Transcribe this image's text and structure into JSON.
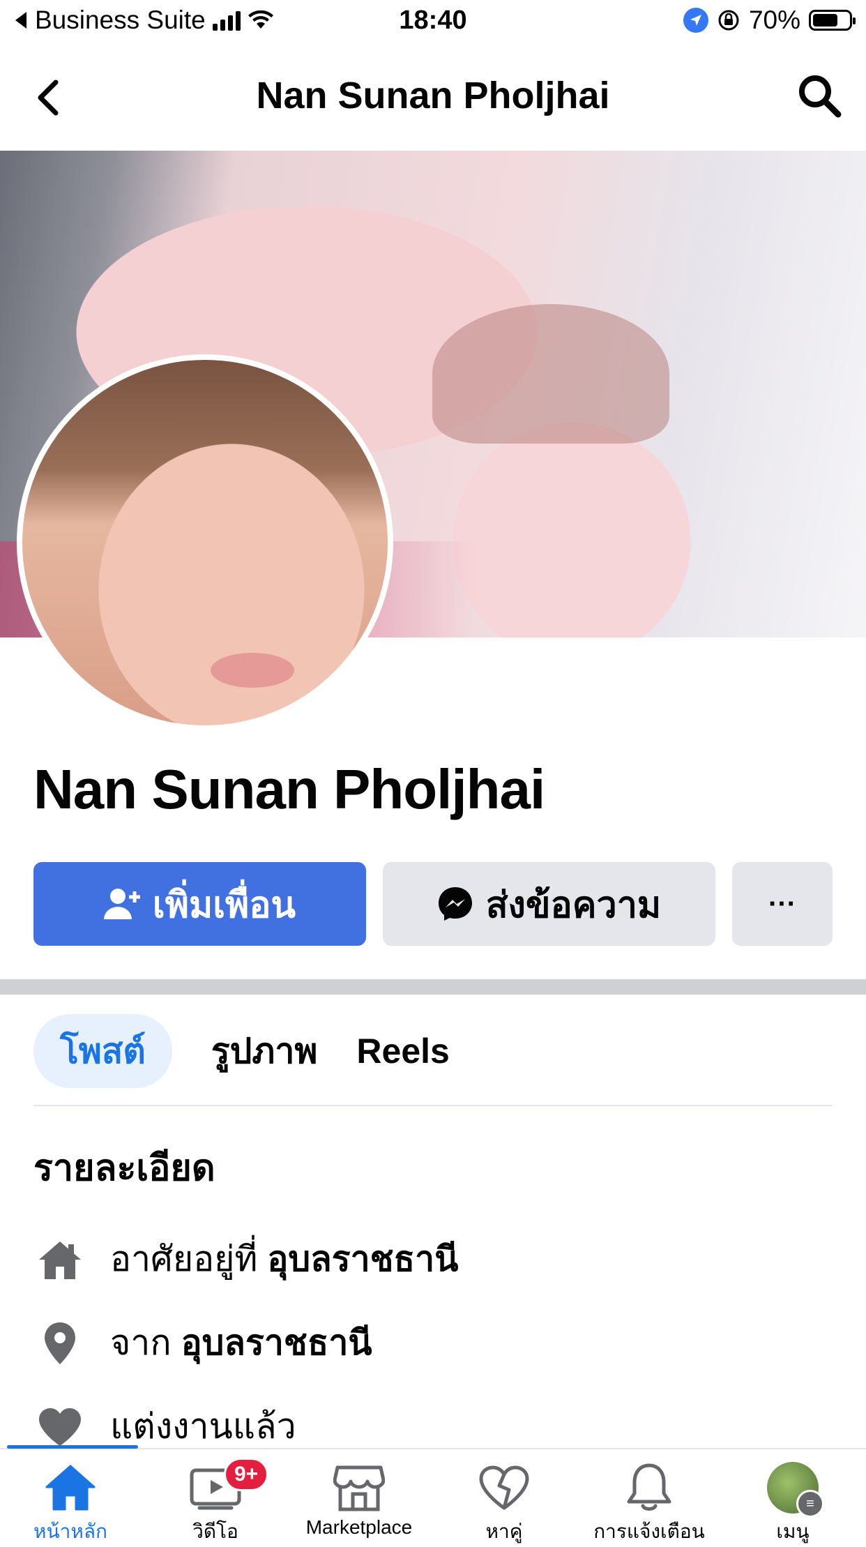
{
  "status_bar": {
    "carrier": "Business Suite",
    "time": "18:40",
    "battery": "70%",
    "battery_level": 0.7
  },
  "header": {
    "title": "Nan Sunan Pholjhai"
  },
  "profile": {
    "name": "Nan Sunan Pholjhai"
  },
  "actions": {
    "add_friend": "เพิ่มเพื่อน",
    "message": "ส่งข้อความ",
    "more": "···"
  },
  "tabs": [
    {
      "label": "โพสต์",
      "active": true
    },
    {
      "label": "รูปภาพ",
      "active": false
    },
    {
      "label": "Reels",
      "active": false
    }
  ],
  "details": {
    "title": "รายละเอียด",
    "items": [
      {
        "icon": "home-icon",
        "prefix": "อาศัยอยู่ที่",
        "value": "อุบลราชธานี"
      },
      {
        "icon": "location-pin-icon",
        "prefix": "จาก",
        "value": "อุบลราชธานี"
      },
      {
        "icon": "heart-icon",
        "prefix": "แต่งงานแล้ว",
        "value": ""
      }
    ]
  },
  "tabbar": {
    "items": [
      {
        "label": "หน้าหลัก",
        "icon": "home-icon"
      },
      {
        "label": "วิดีโอ",
        "icon": "video-icon",
        "badge": "9+"
      },
      {
        "label": "Marketplace",
        "icon": "marketplace-icon"
      },
      {
        "label": "หาคู่",
        "icon": "dating-icon"
      },
      {
        "label": "การแจ้งเตือน",
        "icon": "bell-icon"
      },
      {
        "label": "เมนู",
        "icon": "menu-avatar-icon"
      }
    ]
  },
  "colors": {
    "accent": "#1b74e4",
    "button_primary": "#4170e1",
    "button_secondary": "#e4e6eb",
    "badge": "#e41e3f"
  }
}
